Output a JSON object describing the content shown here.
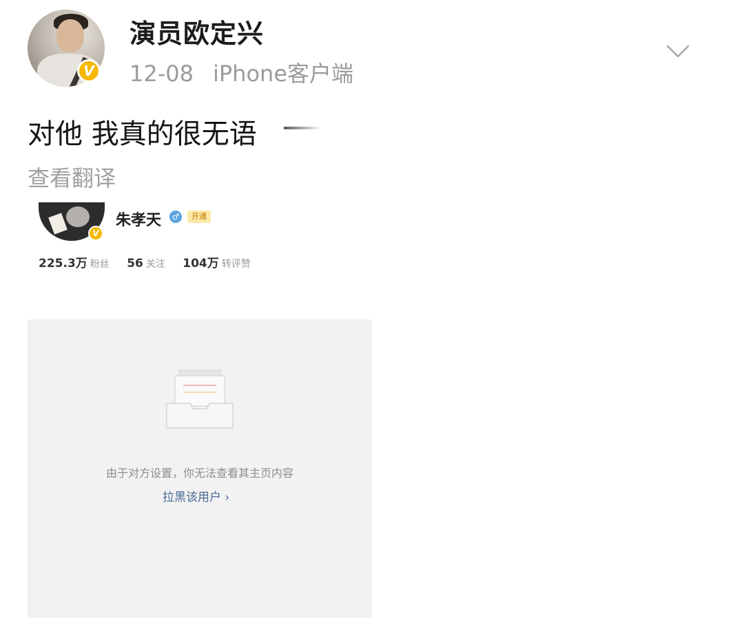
{
  "post": {
    "author": "演员欧定兴",
    "date": "12-08",
    "source": "iPhone客户端",
    "text": "对他 我真的很无语",
    "translate_label": "查看翻译",
    "verified_badge": "V"
  },
  "embed": {
    "username": "朱孝天",
    "gender_icon": "♂",
    "vip_label": "开通",
    "verified_badge": "V",
    "stats": [
      {
        "value": "225.3万",
        "label": "粉丝"
      },
      {
        "value": "56",
        "label": "关注"
      },
      {
        "value": "104万",
        "label": "转评赞"
      }
    ],
    "blocked_message": "由于对方设置，你无法查看其主页内容",
    "block_link": "拉黑该用户 ›"
  },
  "colors": {
    "verified": "#f6b800",
    "meta_gray": "#9b9b9b",
    "link_blue": "#4a6a94",
    "panel_bg": "#f2f2f2"
  },
  "icons": [
    "chevron-down-icon",
    "empty-box-icon",
    "gender-icon"
  ]
}
